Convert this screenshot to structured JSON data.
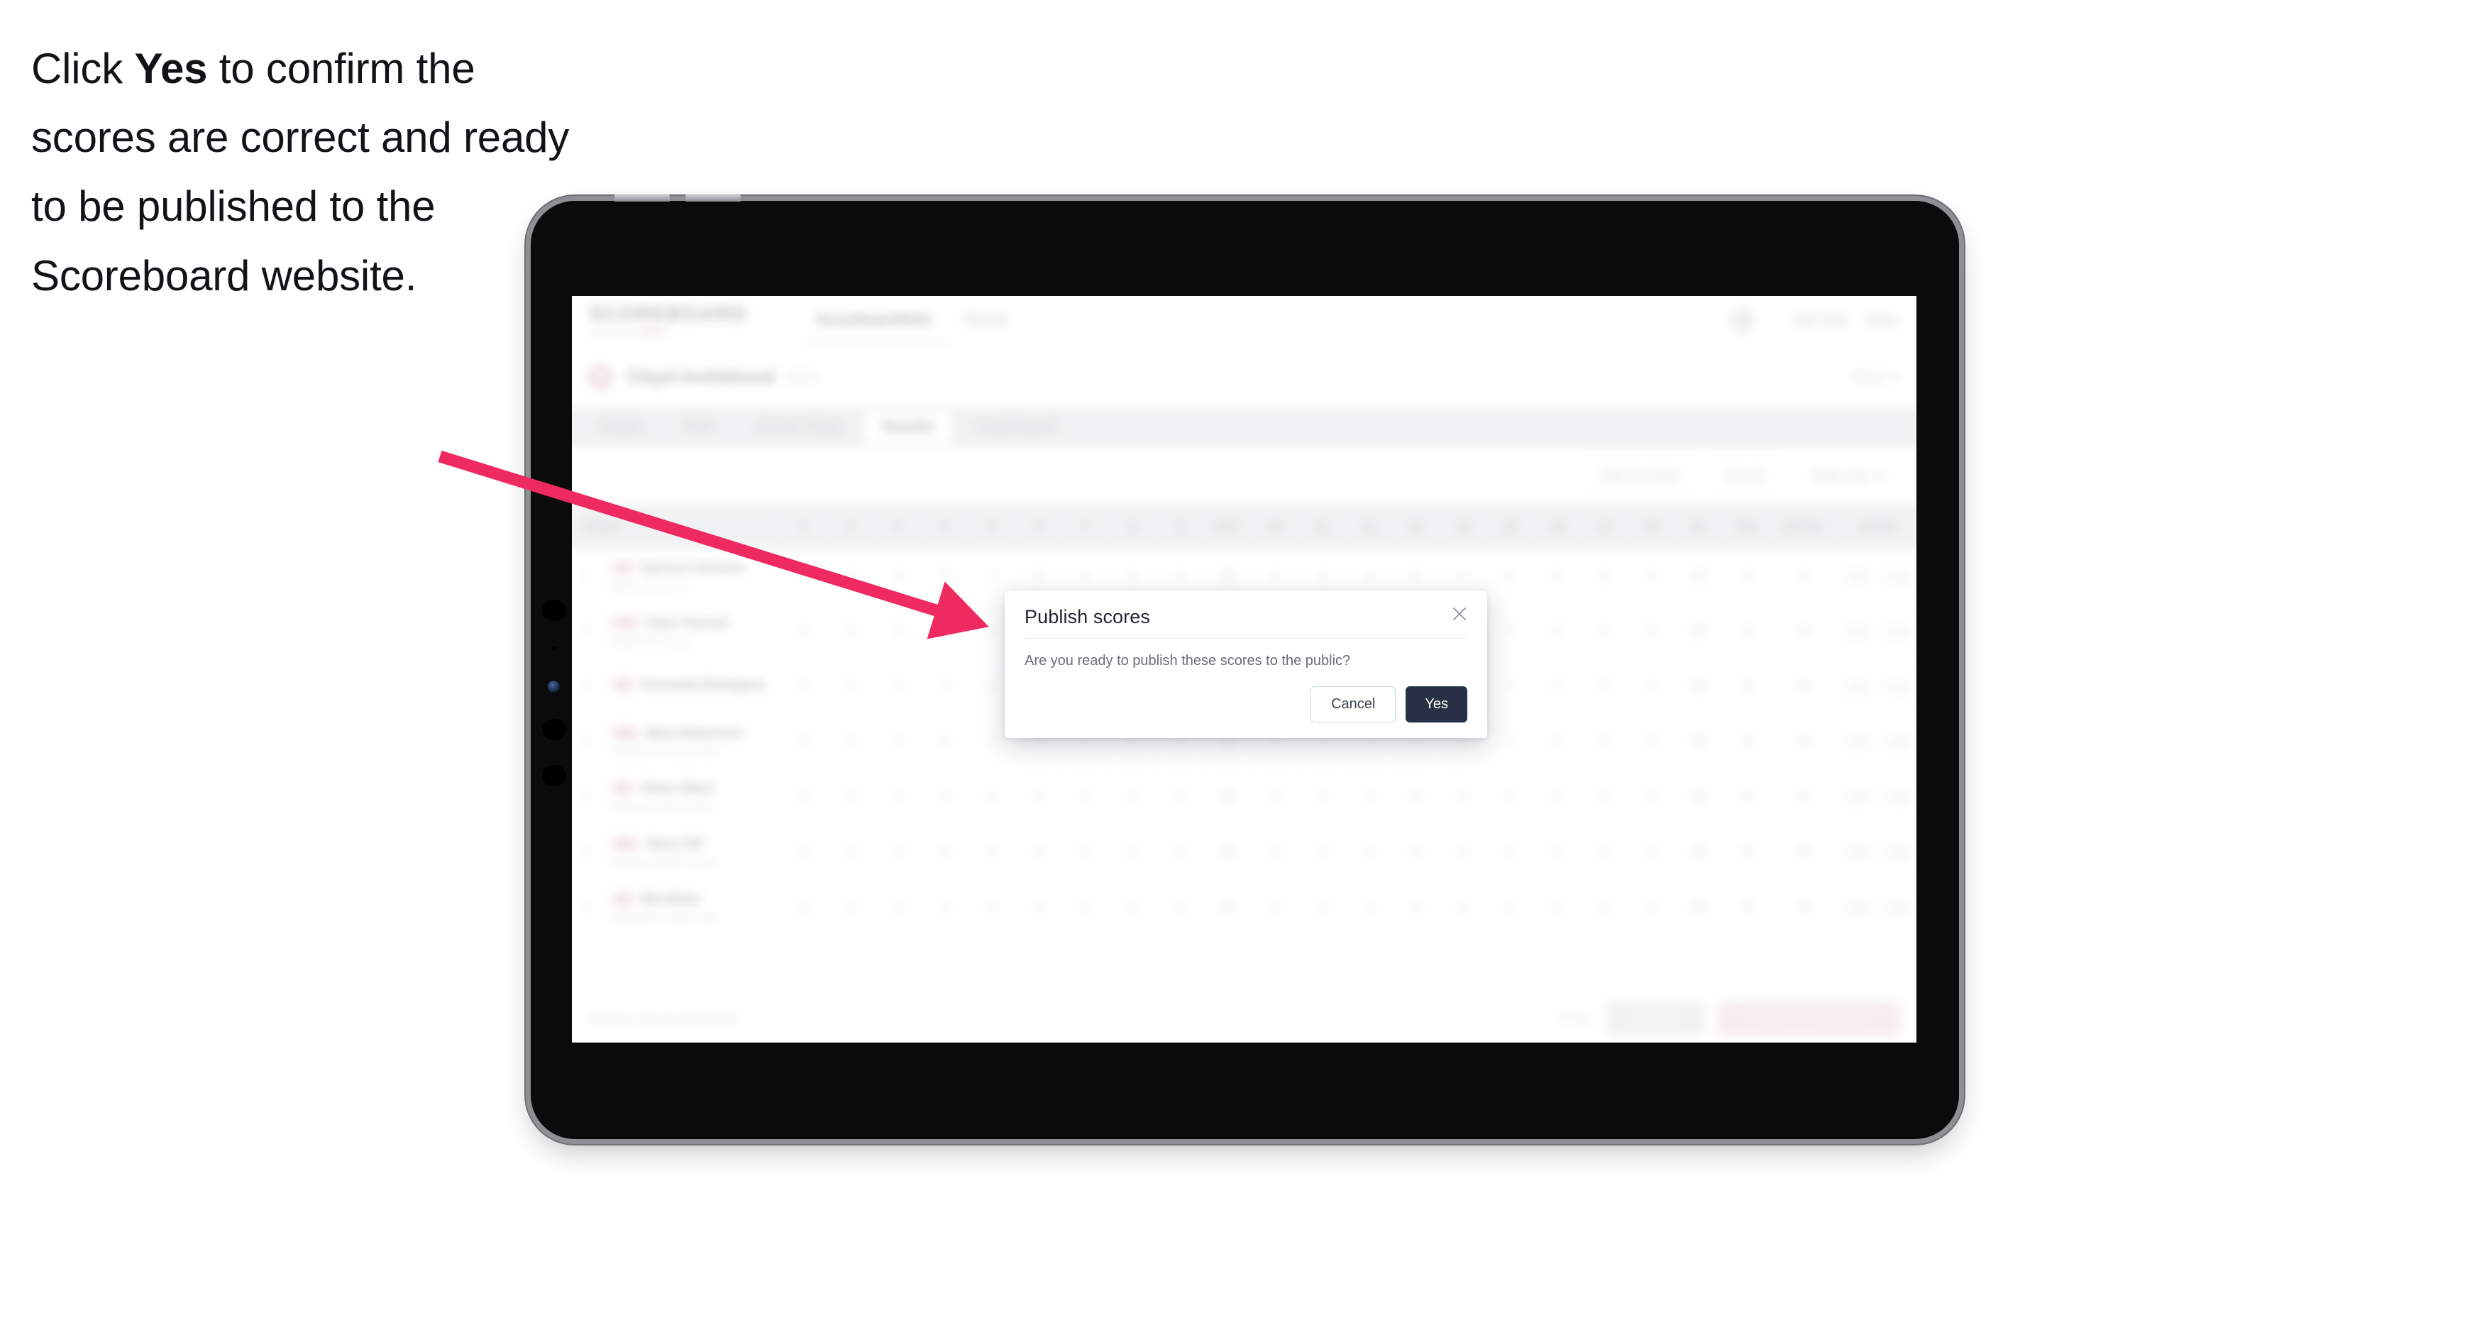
{
  "caption": {
    "before": "Click ",
    "emphasis": "Yes",
    "after": " to confirm the scores are correct and ready to be published to the Scoreboard website."
  },
  "colors": {
    "accent_pink": "#ef2a60",
    "arrow_pink": "#ee2a61",
    "primary_dark": "#273044",
    "tabbar_grey": "#d4d7dc",
    "device_body": "#0b0b0c",
    "device_bezel": "#8e9094"
  },
  "modal": {
    "title": "Publish scores",
    "body": "Are you ready to publish these scores to the public?",
    "close_icon": "close-icon",
    "cancel_label": "Cancel",
    "confirm_label": "Yes"
  },
  "app": {
    "brand": {
      "name": "SCOREBOARD",
      "sub_prefix": "powered by ",
      "sub_accent": "GOLF"
    },
    "top_nav": [
      {
        "label": "Scoreboard/Info",
        "active": true
      },
      {
        "label": "Result",
        "active": false
      }
    ],
    "header_right": {
      "avatar": "avatar",
      "links": [
        "Bell Gully",
        "Menu"
      ]
    },
    "competition": {
      "icon": "competition-icon",
      "title": "Clayd Invitational",
      "date": "2024",
      "right_meta": "Week 3"
    },
    "tabs": [
      {
        "label": "Details",
        "active": false
      },
      {
        "label": "Field",
        "active": false
      },
      {
        "label": "Course Setup",
        "active": false
      },
      {
        "label": "Results",
        "active": true
      },
      {
        "label": "Leaderboard",
        "active": false
      }
    ],
    "filters": {
      "left_label": "",
      "controls": [
        {
          "label": "Filter by team",
          "type": "pill"
        },
        {
          "label": "Round",
          "type": "pill"
        },
        {
          "label": "Team only",
          "type": "chevron"
        }
      ]
    },
    "table": {
      "header": {
        "player": "Player",
        "holes": [
          "1",
          "2",
          "3",
          "4",
          "5",
          "6",
          "7",
          "8",
          "9",
          "OUT",
          "10",
          "11",
          "12",
          "13",
          "14",
          "15",
          "16",
          "17",
          "18",
          "IN"
        ],
        "par": "Par",
        "points": "Points",
        "total": "Action"
      },
      "rows": [
        {
          "badge": "AM",
          "name": "Spencer Dawson",
          "meta": "Walnut Grove GC",
          "holes": [
            "4",
            "4",
            "3",
            "5",
            "4",
            "3",
            "4",
            "5",
            "4",
            "36",
            "4",
            "3",
            "4",
            "5",
            "4",
            "4",
            "3",
            "5",
            "4",
            "36"
          ],
          "par": "72",
          "points": "71",
          "btn1": "Edit",
          "btn2": "View"
        },
        {
          "badge": "PRO",
          "name": "Piper Pannell",
          "meta": "Ridge Hill Country",
          "holes": [
            "4",
            "5",
            "3",
            "4",
            "4",
            "3",
            "5",
            "4",
            "4",
            "36",
            "4",
            "4",
            "3",
            "5",
            "4",
            "3",
            "4",
            "4",
            "5",
            "36"
          ],
          "par": "72",
          "points": "73",
          "btn1": "Edit",
          "btn2": "View"
        },
        {
          "badge": "AM",
          "name": "Fernanda Rodriguez",
          "meta": "",
          "holes": [
            "5",
            "4",
            "3",
            "4",
            "5",
            "3",
            "4",
            "4",
            "4",
            "36",
            "4",
            "3",
            "5",
            "4",
            "4",
            "4",
            "3",
            "5",
            "4",
            "36"
          ],
          "par": "72",
          "points": "74",
          "btn1": "Edit",
          "btn2": "View"
        },
        {
          "badge": "PRO",
          "name": "Maia Robertson",
          "meta": "Lakeshore Country Club",
          "holes": [
            "4",
            "4",
            "4",
            "5",
            "4",
            "3",
            "4",
            "5",
            "3",
            "36",
            "5",
            "3",
            "4",
            "4",
            "4",
            "4",
            "3",
            "5",
            "4",
            "36"
          ],
          "par": "72",
          "points": "70",
          "btn1": "Edit",
          "btn2": "View"
        },
        {
          "badge": "AM",
          "name": "Oliver Ward",
          "meta": "Northland Golf Country",
          "holes": [
            "4",
            "5",
            "3",
            "4",
            "4",
            "4",
            "4",
            "4",
            "4",
            "36",
            "4",
            "4",
            "3",
            "5",
            "4",
            "3",
            "4",
            "5",
            "4",
            "36"
          ],
          "par": "72",
          "points": "72",
          "btn1": "Edit",
          "btn2": "View"
        },
        {
          "badge": "PRO",
          "name": "Harry Hill",
          "meta": "Beechwood Hill Country",
          "holes": [
            "4",
            "4",
            "3",
            "5",
            "4",
            "3",
            "5",
            "4",
            "4",
            "36",
            "4",
            "3",
            "4",
            "5",
            "4",
            "4",
            "3",
            "4",
            "5",
            "36"
          ],
          "par": "72",
          "points": "75",
          "btn1": "Edit",
          "btn2": "View"
        },
        {
          "badge": "AM",
          "name": "Mia Baker",
          "meta": "Eastbrook Country Club",
          "holes": [
            "4",
            "4",
            "4",
            "4",
            "4",
            "3",
            "4",
            "5",
            "4",
            "36",
            "4",
            "4",
            "3",
            "4",
            "5",
            "4",
            "3",
            "5",
            "4",
            "36"
          ],
          "par": "72",
          "points": "73",
          "btn1": "Edit",
          "btn2": "View"
        }
      ]
    },
    "footer": {
      "note": "Scores not yet published",
      "link": "Reset",
      "secondary_button": "Save draft",
      "primary_button": "Publish to Scoreboard"
    }
  }
}
